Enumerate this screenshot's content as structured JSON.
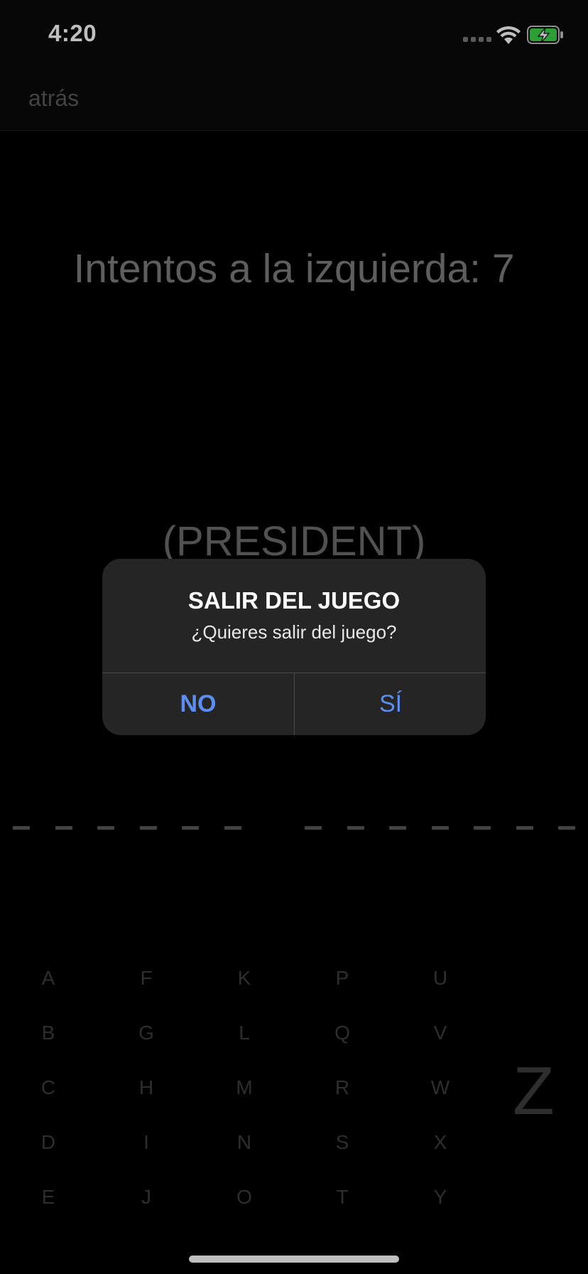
{
  "status_bar": {
    "time": "4:20",
    "battery_color": "#3ed34a"
  },
  "nav": {
    "back_label": "atrás"
  },
  "game": {
    "attempts_label": "Intentos a la izquierda: 7",
    "hint": "(PRESIDENT)",
    "word_blanks": [
      6,
      7
    ]
  },
  "keyboard": {
    "columns": [
      [
        "A",
        "B",
        "C",
        "D",
        "E"
      ],
      [
        "F",
        "G",
        "H",
        "I",
        "J"
      ],
      [
        "K",
        "L",
        "M",
        "N",
        "O"
      ],
      [
        "P",
        "Q",
        "R",
        "S",
        "T"
      ],
      [
        "U",
        "V",
        "W",
        "X",
        "Y"
      ]
    ],
    "last_letter": "Z"
  },
  "alert": {
    "title": "SALIR DEL JUEGO",
    "message": "¿Quieres salir del juego?",
    "no_label": "NO",
    "yes_label": "SÍ",
    "button_color": "#5b8ef0"
  }
}
